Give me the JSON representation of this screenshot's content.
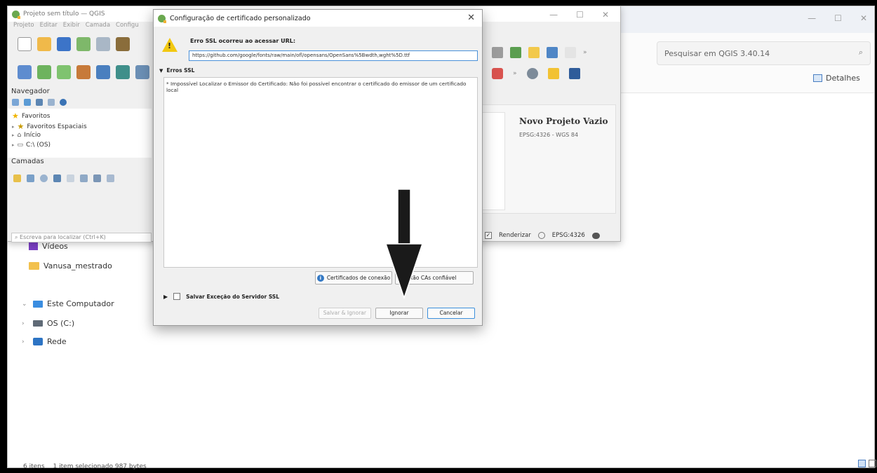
{
  "explorer": {
    "search_placeholder": "Pesquisar em QGIS 3.40.14",
    "details_label": "Detalhes",
    "nav_items": [
      {
        "label": "Vídeos"
      },
      {
        "label": "Vanusa_mestrado"
      },
      {
        "label": "Este Computador"
      },
      {
        "label": "OS (C:)"
      },
      {
        "label": "Rede"
      }
    ],
    "status": {
      "items": "6 itens",
      "selection": "1 item selecionado 987 bytes"
    }
  },
  "qgis": {
    "title": "Projeto sem título — QGIS",
    "menu": [
      "Projeto",
      "Editar",
      "Exibir",
      "Camada",
      "Configu"
    ],
    "navigator_title": "Navegador",
    "navigator_items": [
      "Favoritos",
      "Favoritos Espaciais",
      "Início",
      "C:\\ (OS)"
    ],
    "layers_title": "Camadas",
    "locator_placeholder": "Escreva para localizar (Ctrl+K)",
    "welcome": {
      "project_title": "Novo Projeto Vazio",
      "project_crs": "EPSG:4326 - WGS 84"
    },
    "status": {
      "render_label": "Renderizar",
      "crs_label": "EPSG:4326"
    }
  },
  "dialog": {
    "title": "Configuração de certificado personalizado",
    "error_title": "Erro SSL ocorreu ao acessar URL:",
    "url": "https://github.com/google/fonts/raw/main/ofl/opensans/OpenSans%5Bwdth,wght%5D.ttf",
    "ssl_section": "Erros SSL",
    "ssl_error_text": "* Impossível Localizar o Emissor do Certificado: Não foi possível encontrar o certificado do emissor de um certificado local",
    "btn_certs": "Certificados de conexão",
    "btn_trust": "onexão CAs confiável",
    "save_exception": "Salvar Exceção do Servidor SSL",
    "btn_save_ignore": "Salvar & Ignorar",
    "btn_ignore": "Ignorar",
    "btn_cancel": "Cancelar"
  }
}
